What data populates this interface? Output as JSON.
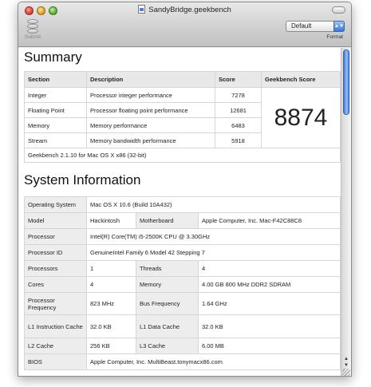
{
  "window": {
    "title": "SandyBridge.geekbench"
  },
  "toolbar": {
    "submit_label": "Submit",
    "format_label": "Format",
    "format_value": "Default"
  },
  "summary": {
    "heading": "Summary",
    "columns": [
      "Section",
      "Description",
      "Score",
      "Geekbench Score"
    ],
    "rows": [
      {
        "section": "Integer",
        "description": "Processor integer performance",
        "score": "7278"
      },
      {
        "section": "Floating Point",
        "description": "Processor floating point performance",
        "score": "12681"
      },
      {
        "section": "Memory",
        "description": "Memory performance",
        "score": "6483"
      },
      {
        "section": "Stream",
        "description": "Memory bandwidth performance",
        "score": "5918"
      }
    ],
    "geekbench_score": "8874",
    "version_note": "Geekbench 2.1.10 for Mac OS X x86 (32-bit)"
  },
  "system_info": {
    "heading": "System Information",
    "operating_system": {
      "label": "Operating System",
      "value": "Mac OS X 10.6 (Build 10A432)"
    },
    "model": {
      "label": "Model",
      "value": "Hackintosh",
      "label2": "Motherboard",
      "value2": "Apple Computer, Inc. Mac-F42C88C8"
    },
    "processor": {
      "label": "Processor",
      "value": "Intel(R) Core(TM) i5-2500K CPU @ 3.30GHz"
    },
    "processor_id": {
      "label": "Processor ID",
      "value": "GenuineIntel Family 6 Model 42 Stepping 7"
    },
    "processors": {
      "label": "Processors",
      "value": "1",
      "label2": "Threads",
      "value2": "4"
    },
    "cores": {
      "label": "Cores",
      "value": "4",
      "label2": "Memory",
      "value2": "4.00 GB  800 MHz DDR2 SDRAM"
    },
    "processor_frequency": {
      "label": "Processor Frequency",
      "value": "823 MHz",
      "label2": "Bus Frequency",
      "value2": "1.64 GHz"
    },
    "l1": {
      "label": "L1 Instruction Cache",
      "value": "32.0 KB",
      "label2": "L1 Data Cache",
      "value2": "32.0 KB"
    },
    "l2": {
      "label": "L2 Cache",
      "value": "256 KB",
      "label2": "L3 Cache",
      "value2": "6.00 MB"
    },
    "bios": {
      "label": "BIOS",
      "value": "Apple Computer, Inc. MultiBeast.tonymacx86.com"
    }
  },
  "icons": {
    "close": "close-icon",
    "minimize": "minimize-icon",
    "zoom": "zoom-icon",
    "submit": "database-icon",
    "document": "document-icon",
    "select": "chevron-up-down-icon"
  }
}
